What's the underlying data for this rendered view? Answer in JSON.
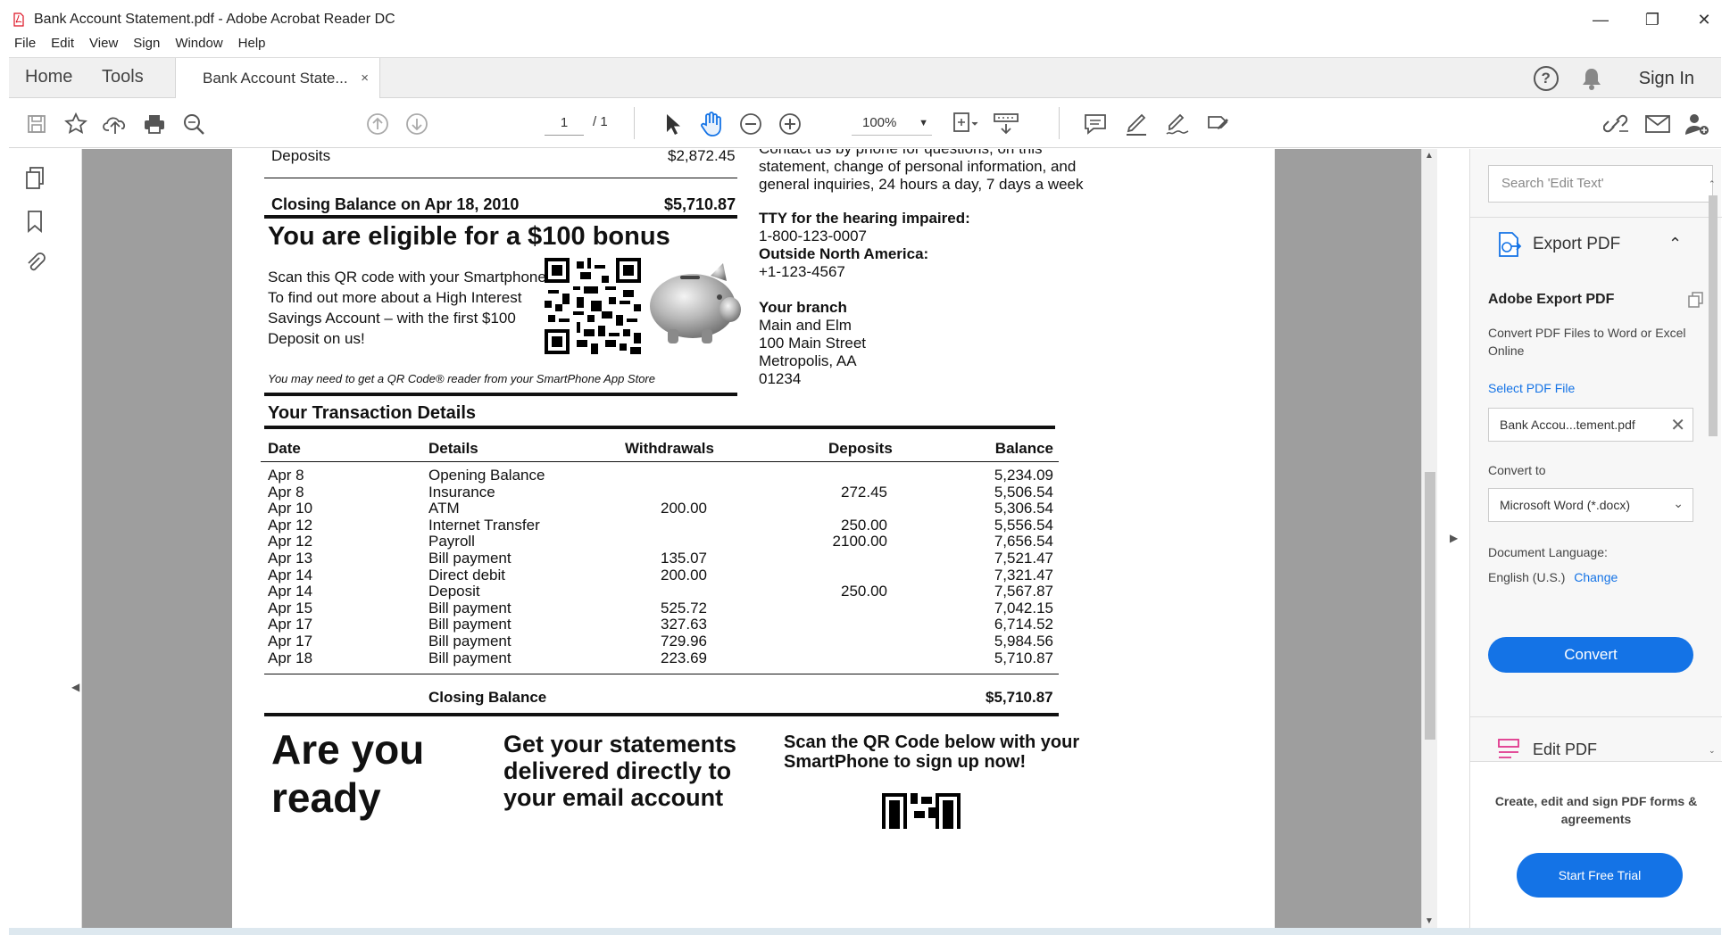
{
  "window": {
    "title": "Bank Account Statement.pdf - Adobe Acrobat Reader DC",
    "controls": [
      "minimize",
      "restore",
      "close"
    ]
  },
  "menu": [
    "File",
    "Edit",
    "View",
    "Sign",
    "Window",
    "Help"
  ],
  "tabs": {
    "home": "Home",
    "tools": "Tools",
    "doc": "Bank Account State...",
    "close": "×",
    "help": "?",
    "sign_in": "Sign In"
  },
  "toolbar": {
    "page_current": "1",
    "page_total": "/ 1",
    "zoom": "100%"
  },
  "statement": {
    "deposits_label": "Deposits",
    "deposits_value": "$2,872.45",
    "closing_label": "Closing Balance on Apr 18, 2010",
    "closing_value": "$5,710.87",
    "bonus_title": "You are eligible for a $100 bonus",
    "bonus_lines": [
      "Scan this QR code with your Smartphone",
      "To find out more about a High Interest",
      "Savings Account – with the first $100",
      "Deposit on us!"
    ],
    "qr_note": "You may need to get a QR Code® reader from your SmartPhone App Store",
    "contact_lines": [
      "Contact us by phone for questions, on this",
      "statement, change of personal information, and",
      "general inquiries, 24 hours a day, 7 days a week"
    ],
    "tty_title": "TTY for the hearing impaired:",
    "tty_number": "1-800-123-0007",
    "outside_title": "Outside North America:",
    "outside_number": "+1-123-4567",
    "branch_title": "Your branch",
    "branch_lines": [
      "Main and Elm",
      "100 Main Street",
      "Metropolis, AA",
      "01234"
    ],
    "tx_title": "Your Transaction Details",
    "tx_headers": [
      "Date",
      "Details",
      "Withdrawals",
      "Deposits",
      "Balance"
    ],
    "tx_rows": [
      [
        "Apr 8",
        "Opening Balance",
        "",
        "",
        "5,234.09"
      ],
      [
        "Apr 8",
        "Insurance",
        "",
        "272.45",
        "5,506.54"
      ],
      [
        "Apr 10",
        "ATM",
        "200.00",
        "",
        "5,306.54"
      ],
      [
        "Apr 12",
        "Internet Transfer",
        "",
        "250.00",
        "5,556.54"
      ],
      [
        "Apr 12",
        "Payroll",
        "",
        "2100.00",
        "7,656.54"
      ],
      [
        "Apr 13",
        "Bill payment",
        "135.07",
        "",
        "7,521.47"
      ],
      [
        "Apr 14",
        "Direct debit",
        "200.00",
        "",
        "7,321.47"
      ],
      [
        "Apr 14",
        "Deposit",
        "",
        "250.00",
        "7,567.87"
      ],
      [
        "Apr 15",
        "Bill payment",
        "525.72",
        "",
        "7,042.15"
      ],
      [
        "Apr 17",
        "Bill payment",
        "327.63",
        "",
        "6,714.52"
      ],
      [
        "Apr 17",
        "Bill payment",
        "729.96",
        "",
        "5,984.56"
      ],
      [
        "Apr 18",
        "Bill payment",
        "223.69",
        "",
        "5,710.87"
      ]
    ],
    "tx_closing_label": "Closing Balance",
    "tx_closing_value": "$5,710.87",
    "promo_ready": "Are you ready",
    "promo_statements": [
      "Get your statements",
      "delivered directly to",
      "your email account"
    ],
    "promo_scan": [
      "Scan the QR Code below with your",
      "SmartPhone to sign up now!"
    ]
  },
  "right_pane": {
    "search_placeholder": "Search 'Edit Text'",
    "export_title": "Export PDF",
    "adobe_export": "Adobe Export PDF",
    "convert_desc": "Convert PDF Files to Word or Excel Online",
    "select_file": "Select PDF File",
    "file_name": "Bank Accou...tement.pdf",
    "convert_to": "Convert to",
    "format": "Microsoft Word (*.docx)",
    "doc_language_label": "Document Language:",
    "doc_language": "English (U.S.)",
    "change": "Change",
    "convert_button": "Convert",
    "edit_pdf": "Edit PDF",
    "promo_text": "Create, edit and sign PDF forms & agreements",
    "trial_button": "Start Free Trial"
  },
  "colors": {
    "accent": "#1473e6",
    "doc_background": "#9e9e9e",
    "toolbar_bg": "#f0f0f0"
  }
}
